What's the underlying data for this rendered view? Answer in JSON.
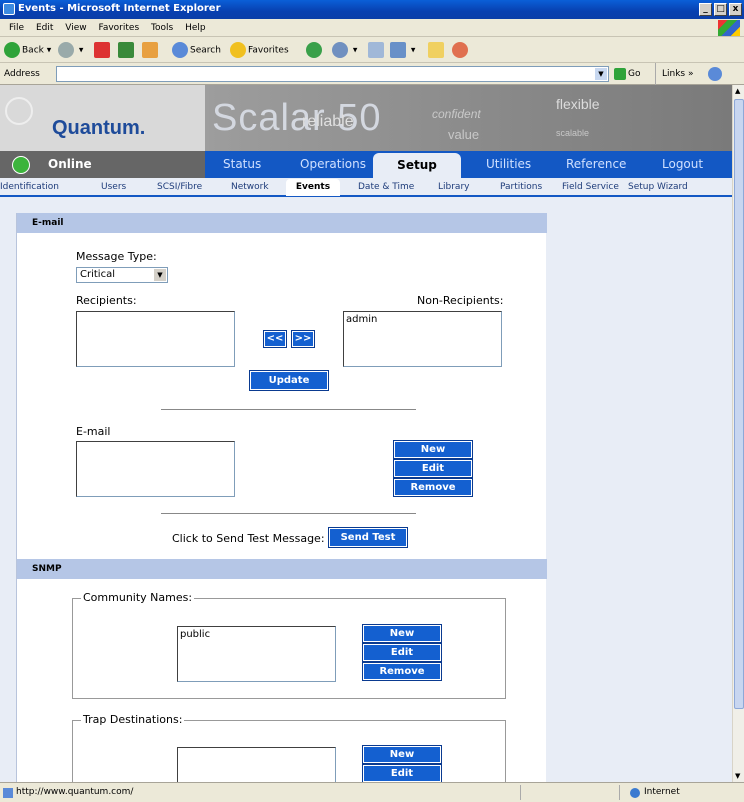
{
  "window": {
    "title": "Events - Microsoft Internet Explorer",
    "min": "_",
    "max": "□",
    "close": "x"
  },
  "menu": [
    "File",
    "Edit",
    "View",
    "Favorites",
    "Tools",
    "Help"
  ],
  "toolbar": {
    "back": "Back",
    "search": "Search",
    "favorites": "Favorites"
  },
  "address": {
    "label": "Address",
    "value": "",
    "go": "Go",
    "links": "Links »"
  },
  "banner": {
    "logo": "Quantum.",
    "product": "Scalar 50",
    "ghost": [
      "reliable",
      "confident",
      "value",
      "flexible",
      "scalable"
    ]
  },
  "nav": {
    "status_online": "Online",
    "tabs": [
      "Status",
      "Operations",
      "Setup",
      "Utilities",
      "Reference",
      "Logout"
    ],
    "active": "Setup"
  },
  "subnav": {
    "tabs": [
      "Identification",
      "Users",
      "SCSI/Fibre",
      "Network",
      "Events",
      "Date & Time",
      "Library",
      "Partitions",
      "Field Service",
      "Setup Wizard"
    ],
    "active": "Events"
  },
  "email": {
    "header": "E-mail",
    "message_type_label": "Message Type:",
    "message_type_value": "Critical",
    "recipients_label": "Recipients:",
    "non_recipients_label": "Non-Recipients:",
    "non_recipients": [
      "admin"
    ],
    "move_left": "<<",
    "move_right": ">>",
    "update": "Update",
    "email_label": "E-mail",
    "new": "New",
    "edit": "Edit",
    "remove": "Remove",
    "test_label": "Click to Send Test Message:",
    "send_test": "Send Test"
  },
  "snmp": {
    "header": "SNMP",
    "community_label": "Community Names:",
    "community": [
      "public"
    ],
    "new": "New",
    "edit": "Edit",
    "remove": "Remove",
    "trap_label": "Trap Destinations:",
    "trap_new": "New",
    "trap_edit": "Edit"
  },
  "status": {
    "url": "http://www.quantum.com/",
    "zone": "Internet"
  }
}
